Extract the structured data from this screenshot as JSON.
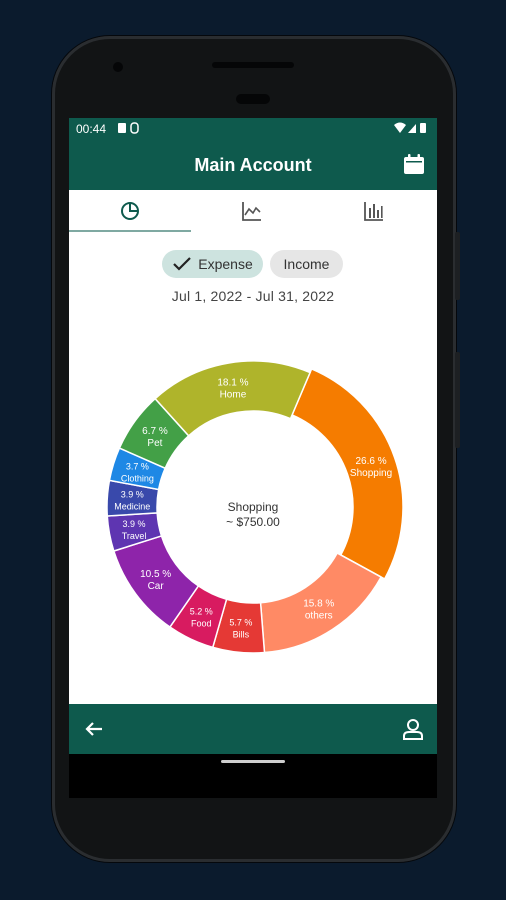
{
  "status": {
    "time": "00:44"
  },
  "appbar": {
    "title": "Main Account"
  },
  "tabs": [
    {
      "name": "pie-chart",
      "icon": "pie-chart-icon",
      "active": true
    },
    {
      "name": "line-chart",
      "icon": "line-chart-icon",
      "active": false
    },
    {
      "name": "bar-chart",
      "icon": "bar-chart-icon",
      "active": false
    }
  ],
  "filter": {
    "expense_label": "Expense",
    "income_label": "Income",
    "selected": "Expense"
  },
  "date_range": "Jul 1, 2022 - Jul 31, 2022",
  "center": {
    "category": "Shopping",
    "amount": "~ $750.00"
  },
  "colors": {
    "primary": "#0e5a4d",
    "chip_selected": "#cde3df",
    "chip": "#e6e6e6"
  },
  "chart_data": {
    "type": "pie",
    "donut": true,
    "categories": [
      "Shopping",
      "others",
      "Bills",
      "Food",
      "Car",
      "Travel",
      "Medicine",
      "Clothing",
      "Pet",
      "Home"
    ],
    "values": [
      26.6,
      15.8,
      5.7,
      5.2,
      10.5,
      3.9,
      3.9,
      3.7,
      6.7,
      18.1
    ],
    "labels": [
      "26.6 %",
      "15.8 %",
      "5.7 %",
      "5.2 %",
      "10.5 %",
      "3.9 %",
      "3.9 %",
      "3.7 %",
      "6.7 %",
      "18.1 %"
    ],
    "colors": [
      "#f57c00",
      "#ff8a65",
      "#e53935",
      "#d81b60",
      "#8e24aa",
      "#5e35b1",
      "#3949ab",
      "#1e88e5",
      "#43a047",
      "#afb42b"
    ],
    "selected": "Shopping"
  }
}
